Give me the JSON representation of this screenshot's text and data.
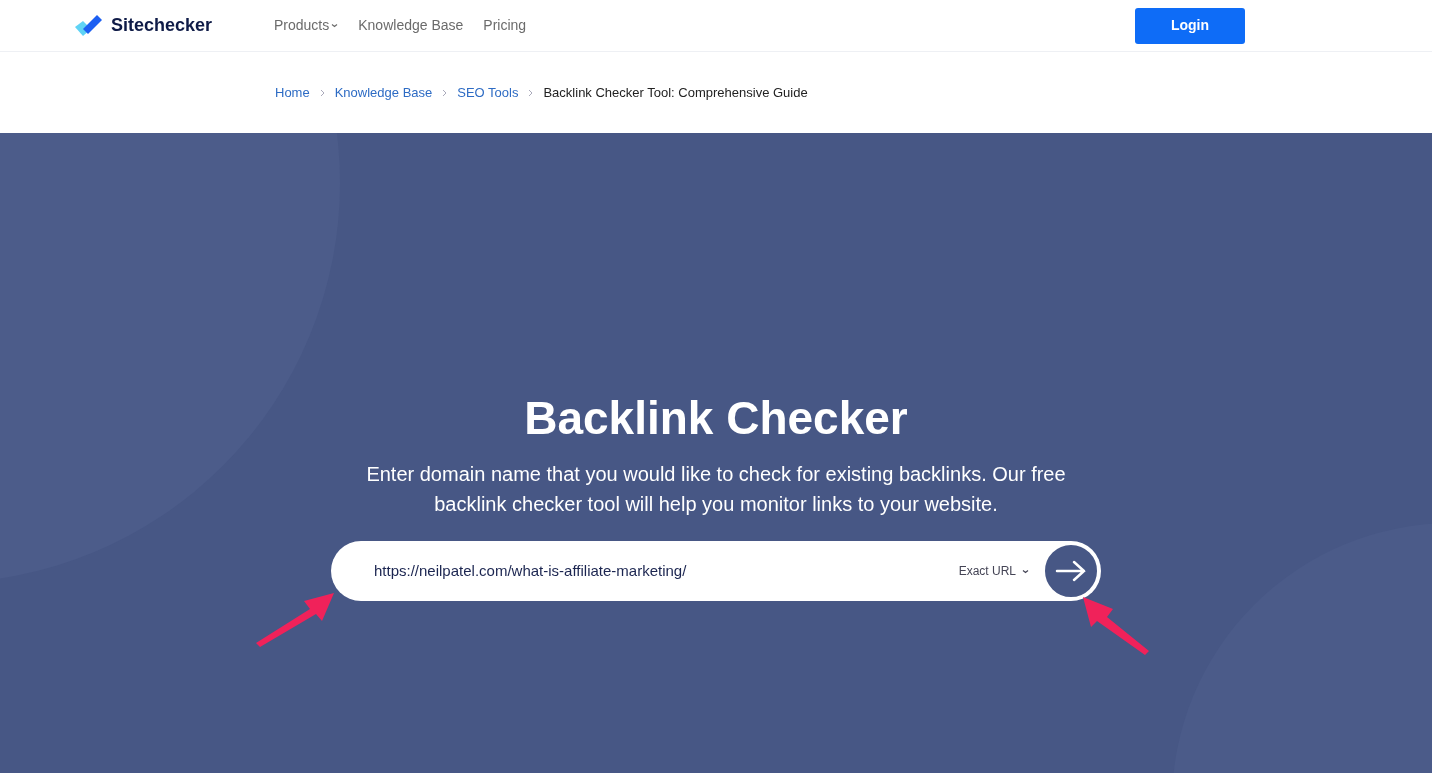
{
  "header": {
    "logo": "Sitechecker",
    "nav": [
      {
        "label": "Products",
        "kind": "dropdown"
      },
      {
        "label": "Knowledge Base",
        "kind": "link"
      },
      {
        "label": "Pricing",
        "kind": "link"
      }
    ],
    "login": "Login"
  },
  "breadcrumbs": [
    {
      "label": "Home",
      "kind": "link"
    },
    {
      "label": "Knowledge Base",
      "kind": "link"
    },
    {
      "label": "SEO Tools",
      "kind": "link"
    },
    {
      "label": "Backlink Checker Tool: Comprehensive Guide",
      "kind": "current"
    }
  ],
  "hero": {
    "title": "Backlink Checker",
    "subtitle": "Enter domain name that you would like to check for existing backlinks. Our free backlink checker tool will help you monitor links to your website.",
    "url_field": {
      "value": "https://neilpatel.com/what-is-affiliate-marketing/"
    },
    "mode": "Exact URL"
  }
}
